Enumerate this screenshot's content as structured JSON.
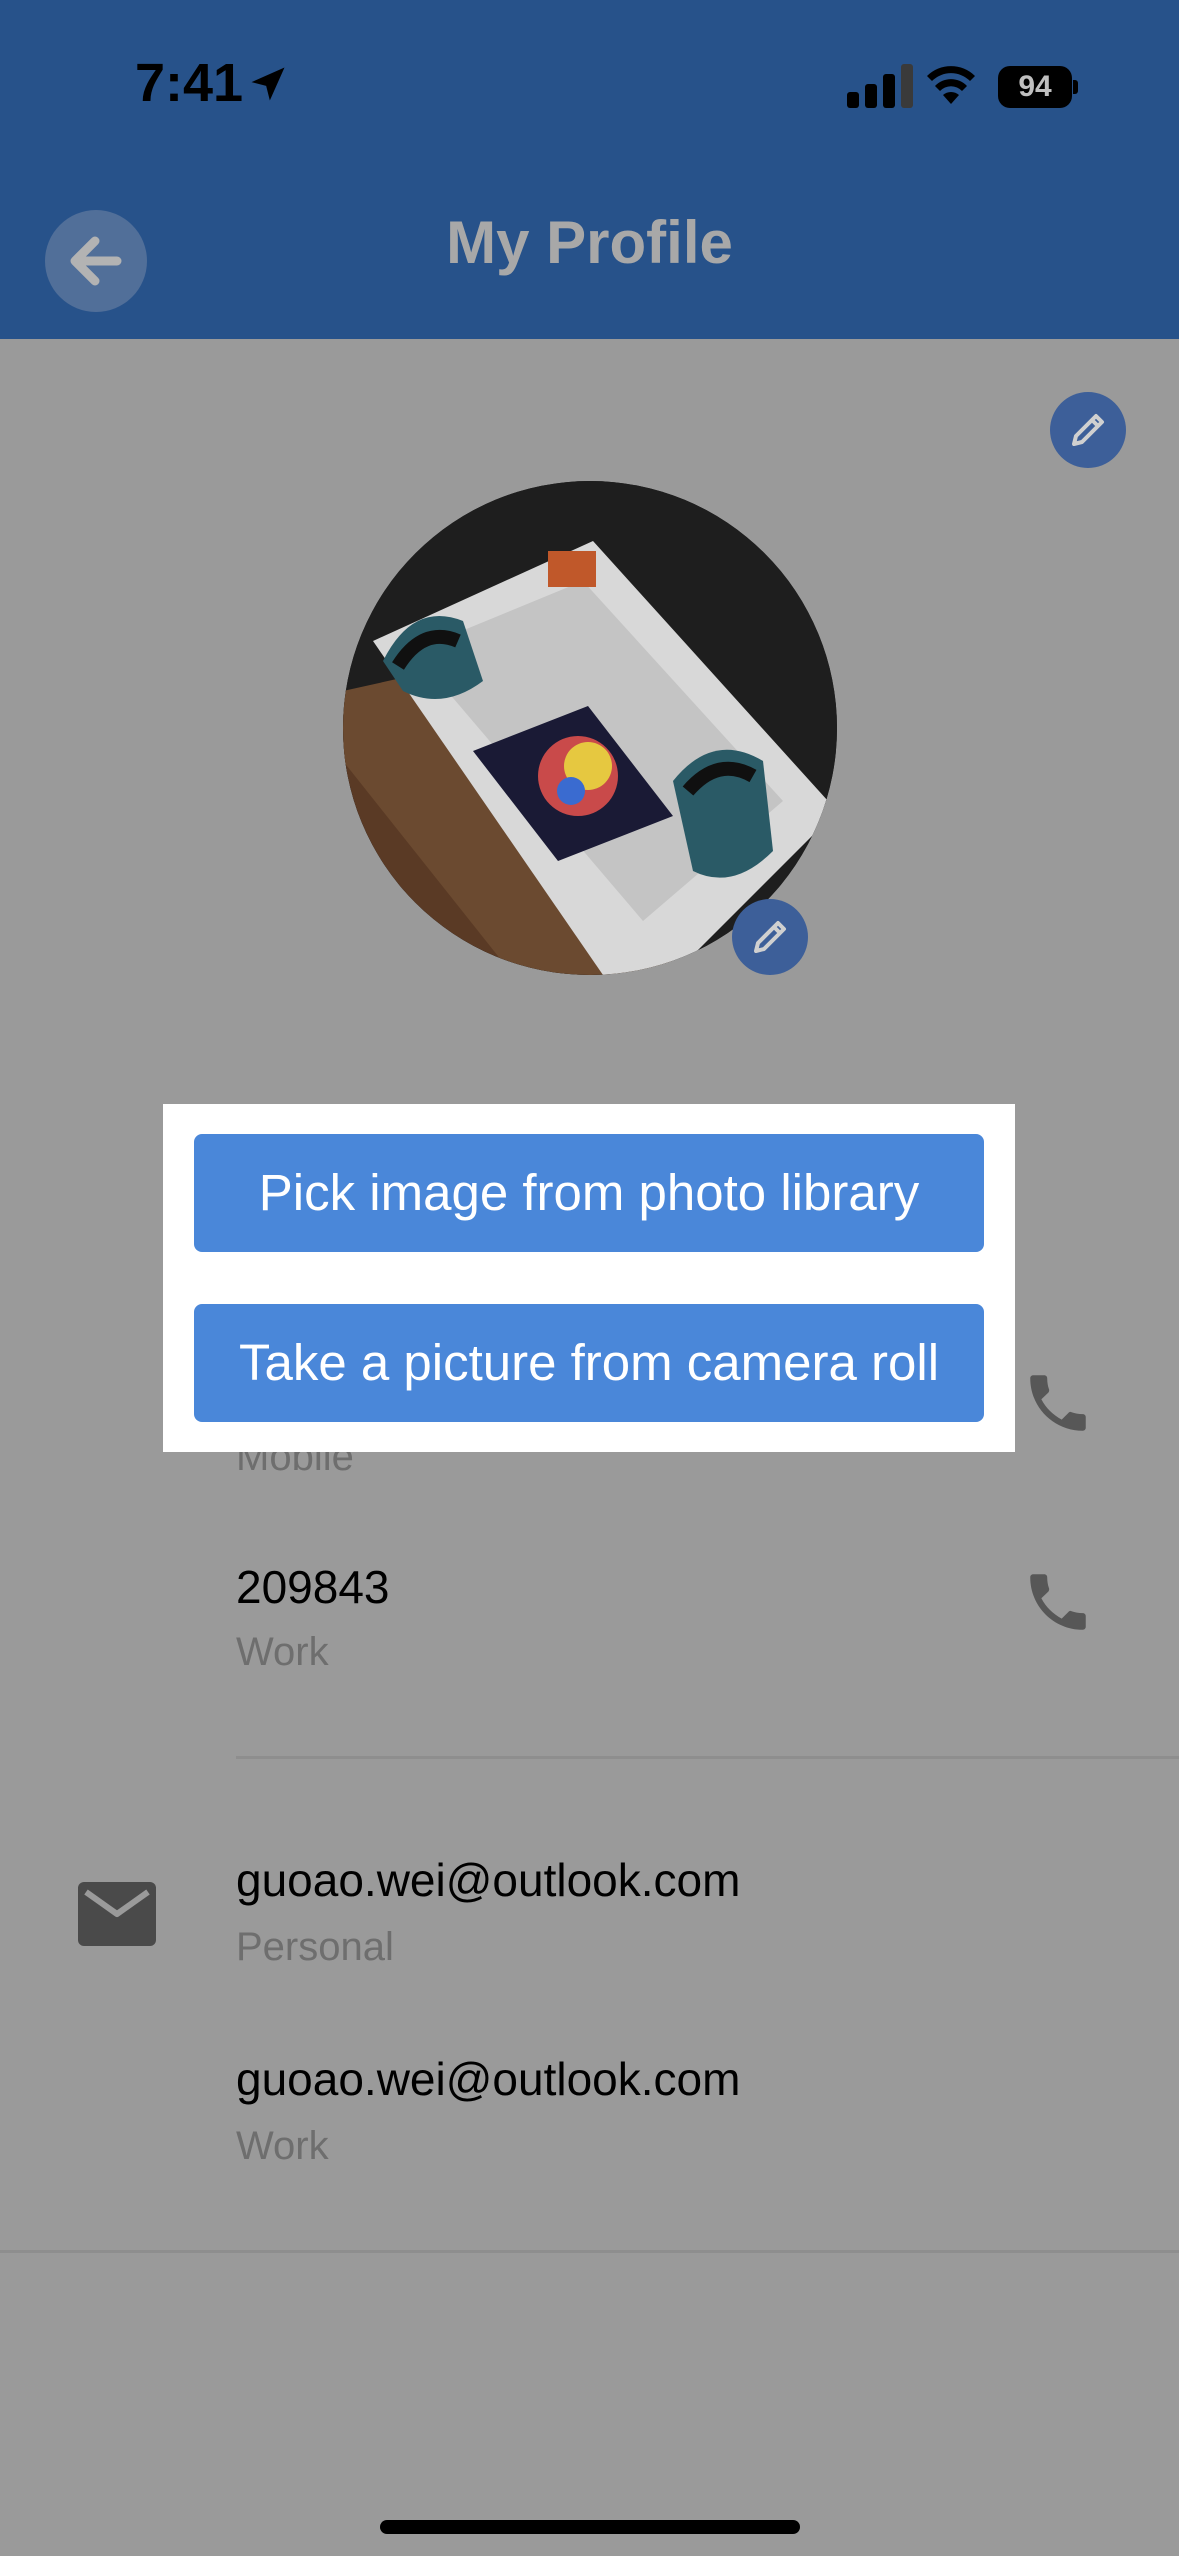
{
  "status_bar": {
    "time": "7:41",
    "battery": "94"
  },
  "header": {
    "title": "My Profile"
  },
  "contacts": {
    "phones": [
      {
        "number": "",
        "type": "Mobile"
      },
      {
        "number": "209843",
        "type": "Work"
      }
    ],
    "emails": [
      {
        "address": "guoao.wei@outlook.com",
        "type": "Personal"
      },
      {
        "address": "guoao.wei@outlook.com",
        "type": "Work"
      }
    ]
  },
  "image_picker": {
    "library_label": "Pick image from photo library",
    "camera_label": "Take a picture from camera roll"
  },
  "colors": {
    "header_bg": "#27528a",
    "accent": "#4a87d9",
    "overlay": "#9a9a9a"
  },
  "icons": [
    "location-arrow-icon",
    "signal-icon",
    "wifi-icon",
    "battery-icon",
    "back-arrow-icon",
    "pencil-icon",
    "phone-icon",
    "mail-icon"
  ]
}
